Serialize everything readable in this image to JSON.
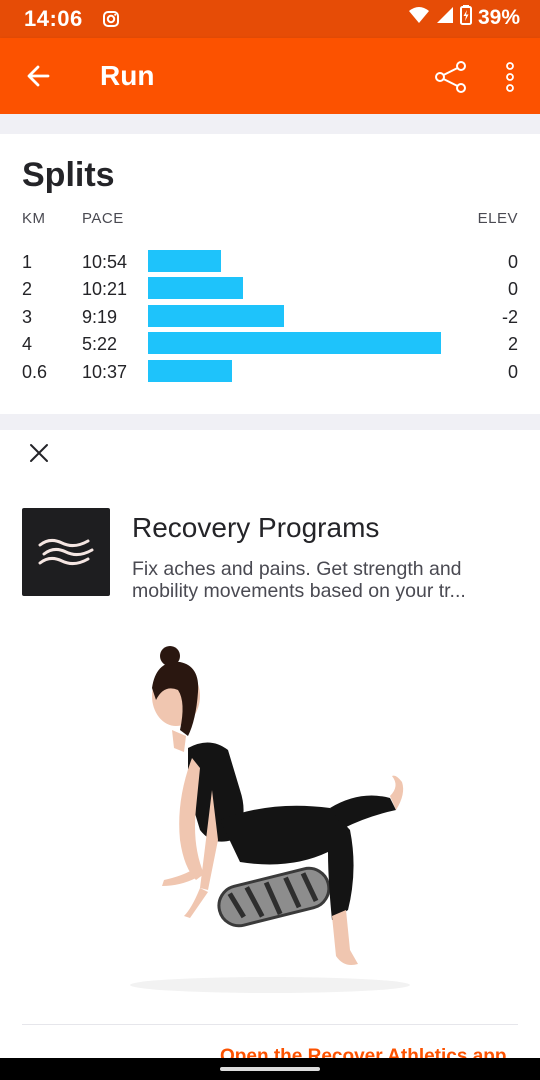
{
  "status_bar": {
    "time": "14:06",
    "battery_percent": "39%",
    "icons": [
      "instagram-icon",
      "wifi-icon",
      "signal-icon",
      "battery-charging-icon"
    ]
  },
  "app_bar": {
    "title": "Run",
    "icons": [
      "back-arrow-icon",
      "share-icon",
      "more-vert-icon"
    ],
    "color": "#fc5200"
  },
  "splits": {
    "title": "Splits",
    "col_km": "KM",
    "col_pace": "PACE",
    "col_elev": "ELEV",
    "bar_color": "#1ec3fb",
    "rows": [
      {
        "km": "1",
        "pace": "10:54",
        "elev": "0",
        "pace_seconds": 654
      },
      {
        "km": "2",
        "pace": "10:21",
        "elev": "0",
        "pace_seconds": 621
      },
      {
        "km": "3",
        "pace": "9:19",
        "elev": "-2",
        "pace_seconds": 559
      },
      {
        "km": "4",
        "pace": "5:22",
        "elev": "2",
        "pace_seconds": 322
      },
      {
        "km": "0.6",
        "pace": "10:37",
        "elev": "0",
        "pace_seconds": 637
      }
    ]
  },
  "promo": {
    "title": "Recovery Programs",
    "description": "Fix aches and pains. Get strength and mobility movements based on your tr...",
    "cta": "Open the Recover Athletics app",
    "icons": [
      "close-icon",
      "recover-athletics-logo-icon"
    ],
    "cta_color": "#fc5200"
  }
}
